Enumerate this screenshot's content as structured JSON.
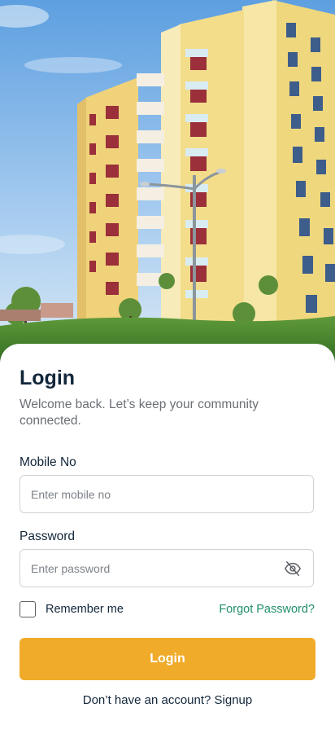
{
  "login": {
    "title": "Login",
    "subtitle": "Welcome back. Let’s keep your community connected.",
    "mobile_label": "Mobile No",
    "mobile_placeholder": "Enter mobile no",
    "mobile_value": "",
    "password_label": "Password",
    "password_placeholder": "Enter password",
    "password_value": "",
    "remember_label": "Remember me",
    "remember_checked": false,
    "forgot_label": "Forgot Password?",
    "login_button": "Login",
    "signup_prompt": "Don’t have an account?",
    "signup_link": "Signup"
  },
  "icons": {
    "password_toggle": "eye-off-icon",
    "checkbox": "checkbox-unchecked-icon"
  },
  "colors": {
    "primary_button": "#f0ab2a",
    "link_green": "#1f8f6a",
    "text_dark": "#12263a",
    "text_muted": "#6b6f75",
    "building_yellow": "#f2d27a",
    "sky_blue": "#78b4e6",
    "grass_green": "#3f7a2a"
  }
}
